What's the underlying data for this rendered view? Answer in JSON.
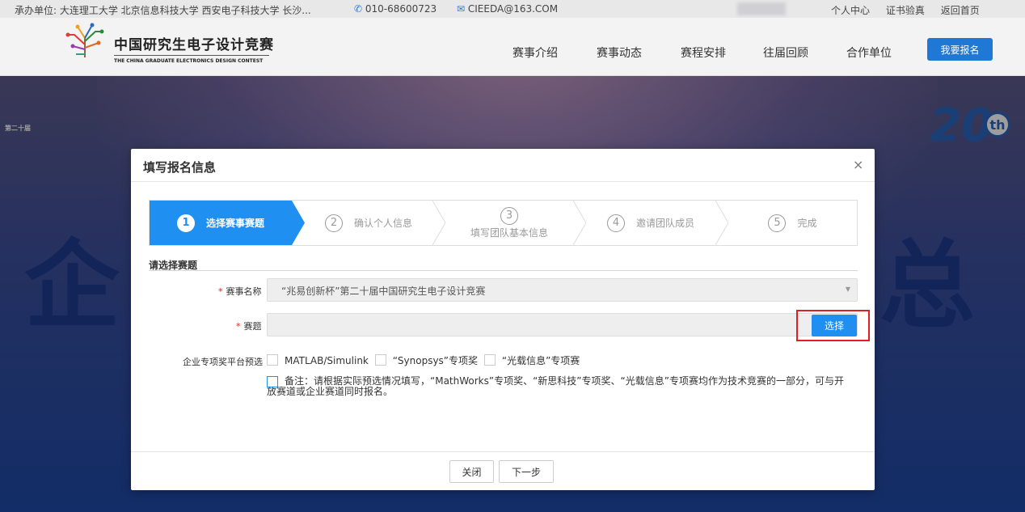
{
  "topbar": {
    "organizers": "承办单位: 大连理工大学 北京信息科技大学 西安电子科技大学 长沙...",
    "phone": "010-68600723",
    "email": "CIEEDA@163.COM",
    "links": [
      "个人中心",
      "证书验真",
      "返回首页"
    ]
  },
  "header": {
    "title": "中国研究生电子设计竞赛",
    "subtitle": "THE CHINA GRADUATE ELECTRONICS DESIGN CONTEST",
    "nav": [
      "赛事介绍",
      "赛事动态",
      "赛程安排",
      "往届回顾",
      "合作单位"
    ],
    "signup": "我要报名"
  },
  "banner": {
    "left_char": "企",
    "right_char": "总",
    "left_badge": "第二十届",
    "anniv_number": "20",
    "anniv_suffix": "th"
  },
  "modal": {
    "title": "填写报名信息",
    "close": "×",
    "steps": [
      {
        "num": "1",
        "label": "选择赛事赛题"
      },
      {
        "num": "2",
        "label": "确认个人信息"
      },
      {
        "num": "3",
        "label": "填写团队基本信息"
      },
      {
        "num": "4",
        "label": "邀请团队成员"
      },
      {
        "num": "5",
        "label": "完成"
      }
    ],
    "active_step": 1,
    "section": "请选择赛题",
    "event_label": "赛事名称",
    "event_value": "“兆易创新杯”第二十届中国研究生电子设计竞赛",
    "topic_label": "赛题",
    "topic_value": "",
    "choose_button": "选择",
    "special_label": "企业专项奖平台预选",
    "options": [
      "MATLAB/Simulink",
      "“Synopsys”专项奖",
      "“光载信息”专项赛"
    ],
    "note": "备注：请根据实际预选情况填写，“MathWorks”专项奖、“新思科技”专项奖、“光载信息”专项赛均作为技术竞赛的一部分，可与开放赛道或企业赛道同时报名。",
    "close_button": "关闭",
    "next_button": "下一步"
  },
  "colors": {
    "accent": "#1f8ff2",
    "brand": "#1f77d6",
    "highlight": "#e02020"
  }
}
